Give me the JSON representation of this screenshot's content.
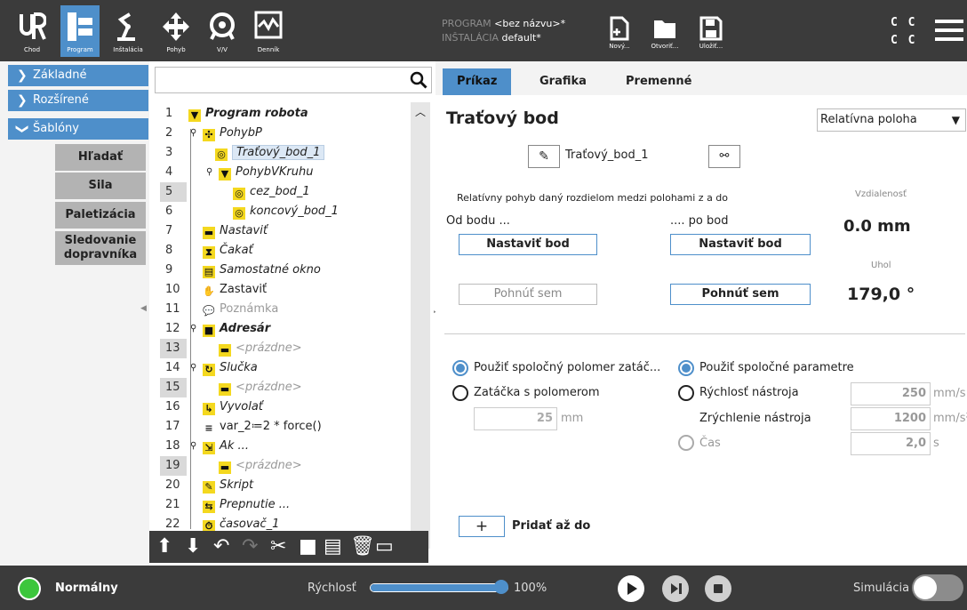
{
  "topbar": {
    "nav": [
      {
        "label": "Chod",
        "icon": "ur-logo-icon"
      },
      {
        "label": "Program",
        "icon": "program-icon"
      },
      {
        "label": "Inštalácia",
        "icon": "robot-arm-icon"
      },
      {
        "label": "Pohyb",
        "icon": "move-icon"
      },
      {
        "label": "V/V",
        "icon": "io-icon"
      },
      {
        "label": "Denník",
        "icon": "log-icon"
      }
    ],
    "program_key": "PROGRAM",
    "program_value": "<bez názvu>*",
    "installation_key": "INŠTALÁCIA",
    "installation_value": "default*",
    "file_buttons": [
      {
        "label": "Nový...",
        "icon": "new-file-icon"
      },
      {
        "label": "Otvoriť...",
        "icon": "open-folder-icon"
      },
      {
        "label": "Uložiť...",
        "icon": "save-icon"
      }
    ],
    "cc_top": "C C",
    "cc_bottom": "C C"
  },
  "leftmenu": {
    "categories": [
      "Základné",
      "Rozšírené",
      "Šablóny"
    ],
    "items": [
      "Hľadať",
      "Sila",
      "Paletizácia",
      "Sledovanie dopravníka"
    ]
  },
  "tree": {
    "rows": [
      {
        "num": "1",
        "label": "Program robota",
        "icon": "▼"
      },
      {
        "num": "2",
        "label": "PohybP",
        "icon": "✣"
      },
      {
        "num": "3",
        "label": "Traťový_bod_1",
        "icon": "◎"
      },
      {
        "num": "4",
        "label": "PohybVKruhu",
        "icon": "▼"
      },
      {
        "num": "5",
        "label": "cez_bod_1",
        "icon": "◎"
      },
      {
        "num": "6",
        "label": "koncový_bod_1",
        "icon": "◎"
      },
      {
        "num": "7",
        "label": "Nastaviť",
        "icon": "▬"
      },
      {
        "num": "8",
        "label": "Čakať",
        "icon": "⧗"
      },
      {
        "num": "9",
        "label": "Samostatné okno",
        "icon": "▤"
      },
      {
        "num": "10",
        "label": "Zastaviť",
        "icon": "✋"
      },
      {
        "num": "11",
        "label": "Poznámka",
        "icon": "💬"
      },
      {
        "num": "12",
        "label": "Adresár",
        "icon": "■"
      },
      {
        "num": "13",
        "label": "<prázdne>",
        "icon": "▬"
      },
      {
        "num": "14",
        "label": "Slučka",
        "icon": "↻"
      },
      {
        "num": "15",
        "label": "<prázdne>",
        "icon": "▬"
      },
      {
        "num": "16",
        "label": "Vyvolať",
        "icon": "↳"
      },
      {
        "num": "17",
        "label": "var_2≔2 * force()",
        "icon": "≡"
      },
      {
        "num": "18",
        "label": "Ak ...",
        "icon": "⇲"
      },
      {
        "num": "19",
        "label": "<prázdne>",
        "icon": "▬"
      },
      {
        "num": "20",
        "label": "Skript",
        "icon": "✎"
      },
      {
        "num": "21",
        "label": "Prepnutie ...",
        "icon": "⇆"
      },
      {
        "num": "22",
        "label": "časovač_1",
        "icon": "⏱"
      }
    ]
  },
  "right": {
    "tabs": [
      "Príkaz",
      "Grafika",
      "Premenné"
    ],
    "title": "Traťový bod",
    "mode_select": "Relatívna poloha",
    "waypoint_name": "Traťový_bod_1",
    "description": "Relatívny pohyb daný rozdielom medzi polohami z a do",
    "distance_label": "Vzdialenosť",
    "distance_value": "0.0 mm",
    "from_label": "Od bodu ...",
    "to_label": ".... po bod",
    "set_point_from": "Nastaviť bod",
    "set_point_to": "Nastaviť bod",
    "angle_label": "Uhol",
    "angle_value": "179,0 °",
    "move_here_from": "Pohnúť sem",
    "move_here_to": "Pohnúť sem",
    "blend_shared": "Použiť spoločný polomer zatáč...",
    "blend_radius": "Zatáčka s polomerom",
    "blend_value": "25",
    "blend_unit": "mm",
    "params_shared": "Použiť spoločné parametre",
    "tool_speed": "Rýchlosť nástroja",
    "tool_speed_value": "250",
    "tool_speed_unit": "mm/s",
    "tool_accel": "Zrýchlenie nástroja",
    "tool_accel_value": "1200",
    "tool_accel_unit": "mm/s²",
    "time": "Čas",
    "time_value": "2,0",
    "time_unit": "s",
    "add_until_symbol": "+",
    "add_until": "Pridať až do"
  },
  "bottombar": {
    "status": "Normálny",
    "speed_label": "Rýchlosť",
    "speed_value": "100%",
    "speed_fraction": 1.0,
    "simulation_label": "Simulácia",
    "colors": {
      "status_green": "#3cc63c",
      "accent": "#4e8fca"
    }
  }
}
